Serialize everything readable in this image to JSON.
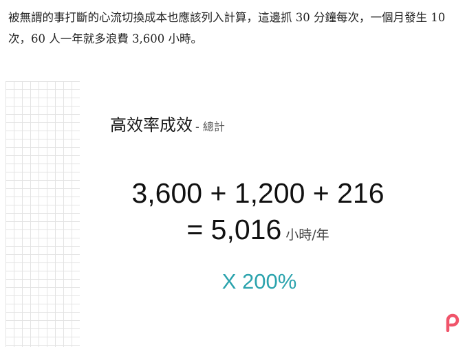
{
  "article": {
    "paragraph": "被無謂的事打斷的心流切換成本也應該列入計算，這邊抓 30 分鐘每次，一個月發生 10 次，60 人一年就多浪費 3,600 小時。"
  },
  "slide": {
    "title": "高效率成效",
    "subtitle": "- 總計",
    "formula_line1": "3,600 + 1,200 + 216",
    "formula_line2": "= 5,016",
    "unit": "小時/年",
    "multiplier": "X 200%",
    "logo_icon": "pinkoi-p-logo-icon",
    "accent_color": "#2ba3ad",
    "logo_color": "#f0546a"
  }
}
